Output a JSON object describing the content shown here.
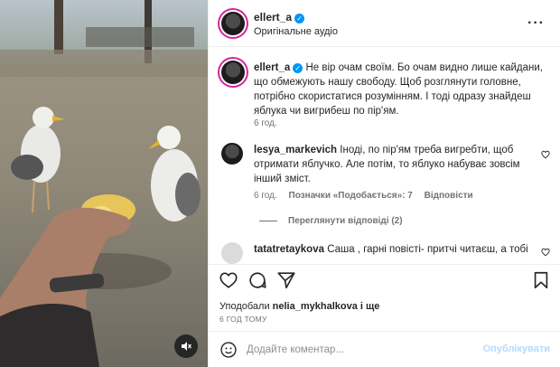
{
  "post": {
    "author": "ellert_a",
    "audio": "Оригінальне аудіо",
    "caption": "Не вір очам своїм. Бо очам видно лише кайдани, що обмежують нашу свободу. Щоб розглянути головне, потрібно скористатися розумінням. І тоді одразу знайдеш яблука чи вигрибеш по пір'ям.",
    "caption_time": "6 год."
  },
  "comments": [
    {
      "user": "lesya_markevich",
      "text": "Іноді, по пір'ям треба вигребти, щоб отримати яблучко. Але потім, то яблуко набуває зовсім інший зміст.",
      "time": "6 год.",
      "likes": "Позначки «Подобається»: 7",
      "reply": "Відповісти",
      "view_replies": "Переглянути відповіді (2)"
    },
    {
      "user": "tatatretaykova",
      "text": "Саша , гарні повісті- притчі читаєш, а тобі"
    }
  ],
  "likes": {
    "prefix": "Уподобали",
    "user": "nelia_mykhalkova",
    "suffix": "і ще"
  },
  "timestamp": "6 ГОД ТОМУ",
  "add_comment": {
    "placeholder": "Додайте коментар...",
    "publish": "Опублікувати"
  },
  "icons": {
    "like": "heart-icon",
    "comment": "comment-icon",
    "share": "share-icon",
    "save": "bookmark-icon",
    "emoji": "emoji-icon",
    "mute": "speaker-muted-icon",
    "more": "more-options-icon",
    "verified": "verified-badge-icon"
  },
  "colors": {
    "verified": "#0095f6",
    "publish_disabled": "#b3dbff",
    "secondary_text": "#737373"
  }
}
